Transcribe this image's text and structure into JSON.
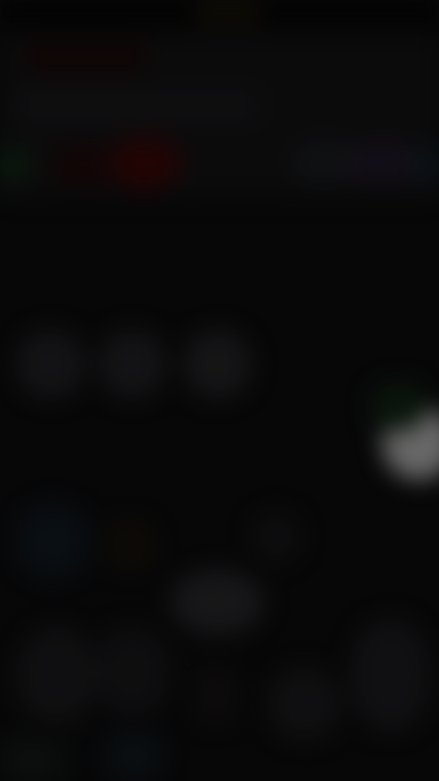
{
  "screen": {
    "state": "blurred",
    "background_color": "#0a0a0b"
  },
  "colors": {
    "header_band": "#0f0f10",
    "red_blob": "#3a0606",
    "grey_blob": "#1e1e20",
    "light_blob": "#bdbdbd",
    "green_tint": "#0f1f12",
    "blue_tint": "#0f1620",
    "purple_tint": "#1a1320"
  }
}
